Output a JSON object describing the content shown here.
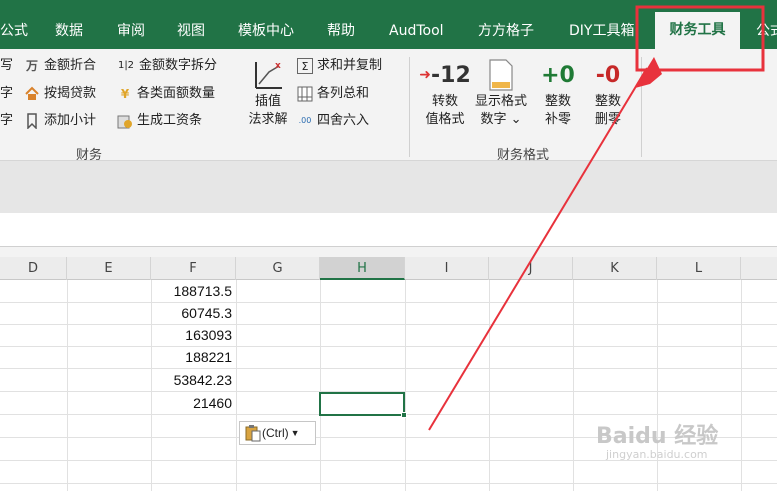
{
  "tabs": [
    {
      "label": "公式",
      "active": false
    },
    {
      "label": "数据",
      "active": false
    },
    {
      "label": "审阅",
      "active": false
    },
    {
      "label": "视图",
      "active": false
    },
    {
      "label": "模板中心",
      "active": false
    },
    {
      "label": "帮助",
      "active": false
    },
    {
      "label": "AudTool",
      "active": false
    },
    {
      "label": "方方格子",
      "active": false
    },
    {
      "label": "DIY工具箱",
      "active": false
    },
    {
      "label": "财务工具",
      "active": true
    },
    {
      "label": "公式",
      "active": false
    }
  ],
  "ribbon": {
    "finance_group": {
      "label": "财务",
      "clipped_col": [
        "写",
        "字",
        "字"
      ],
      "col1": [
        {
          "label": "金额折合",
          "icon": "yuan-icon"
        },
        {
          "label": "按揭贷款",
          "icon": "house-icon"
        },
        {
          "label": "添加小计",
          "icon": "bookmark-icon"
        }
      ],
      "col2": [
        {
          "label": "金额数字拆分",
          "icon": "split-digits-icon"
        },
        {
          "label": "各类面额数量",
          "icon": "money-icon"
        },
        {
          "label": "生成工资条",
          "icon": "payslip-icon"
        }
      ],
      "interp": {
        "line1": "插值",
        "line2": "法求解"
      },
      "col3": [
        {
          "label": "求和并复制",
          "icon": "sum-copy-icon"
        },
        {
          "label": "各列总和",
          "icon": "column-sum-icon"
        },
        {
          "label": "四舍六入",
          "icon": "rounding-icon"
        }
      ]
    },
    "format_group": {
      "label": "财务格式",
      "buttons": [
        {
          "icon_text": "-12",
          "line1": "转数",
          "line2": "值格式"
        },
        {
          "icon_text": "",
          "line1": "显示格式",
          "line2": "数字 ⌄"
        },
        {
          "icon_text": "+0",
          "line1": "整数",
          "line2": "补零"
        },
        {
          "icon_text": "-0",
          "line1": "整数",
          "line2": "删零"
        }
      ]
    }
  },
  "columns": [
    "D",
    "E",
    "F",
    "G",
    "H",
    "I",
    "J",
    "K",
    "L"
  ],
  "selected_column": "H",
  "cells_F": [
    "188713.5",
    "60745.3",
    "163093",
    "188221",
    "53842.23",
    "21460"
  ],
  "paste_button_label": "(Ctrl)",
  "watermark": {
    "text": "Baidu 经验",
    "sub": "jingyan.baidu.com"
  },
  "colors": {
    "accent": "#217346",
    "annotation": "#e8323c"
  }
}
